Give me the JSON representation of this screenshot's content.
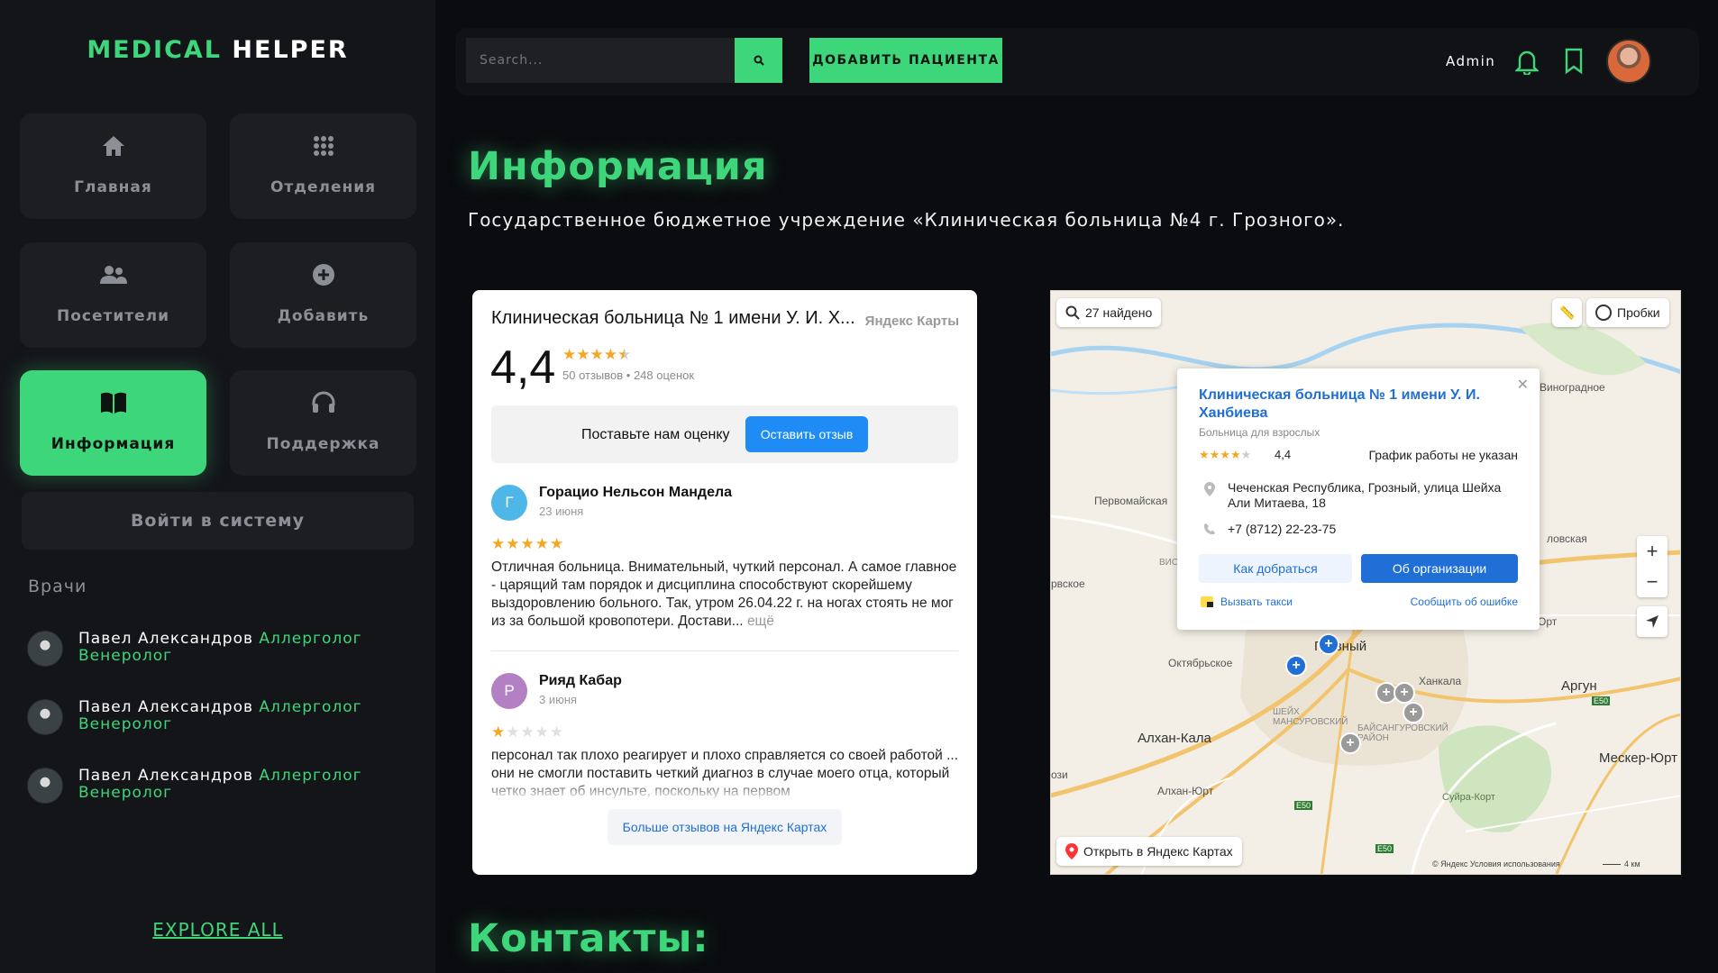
{
  "logo": {
    "part1": "MEDICAL",
    "part2": "HELPER"
  },
  "nav": [
    {
      "label": "Главная",
      "icon": "home-icon"
    },
    {
      "label": "Отделения",
      "icon": "grid-icon"
    },
    {
      "label": "Посетители",
      "icon": "users-icon"
    },
    {
      "label": "Добавить",
      "icon": "plus-circle-icon"
    },
    {
      "label": "Информация",
      "icon": "book-icon",
      "active": true
    },
    {
      "label": "Поддержка",
      "icon": "headset-icon"
    }
  ],
  "login_label": "Войти в систему",
  "doctors": {
    "title": "Врачи",
    "items": [
      {
        "name": "Павел Александров",
        "spec1": "Аллерголог",
        "spec2": "Венеролог"
      },
      {
        "name": "Павел Александров",
        "spec1": "Аллерголог",
        "spec2": "Венеролог"
      },
      {
        "name": "Павел Александров",
        "spec1": "Аллерголог",
        "spec2": "Венеролог"
      }
    ],
    "explore_label": "EXPLORE ALL"
  },
  "topbar": {
    "search_placeholder": "Search...",
    "add_patient_label": "ДОБАВИТЬ ПАЦИЕНТА",
    "user_label": "Admin"
  },
  "main": {
    "title": "Информация",
    "subtitle": "Государственное бюджетное учреждение «Клиническая больница №4 г. Грозного».",
    "contacts_title": "Контакты:"
  },
  "reviews": {
    "title": "Клиническая больница № 1 имени У. И. Х...",
    "brand": "Яндекс Карты",
    "score": "4,4",
    "rating": 4.4,
    "counts": "50 отзывов • 248 оценок",
    "rate_label": "Поставьте нам оценку",
    "rate_button": "Оставить отзыв",
    "items": [
      {
        "initial": "Г",
        "avatar_color": "#4fb6e8",
        "author": "Горацио Нельсон Мандела",
        "date": "23 июня",
        "stars": 5,
        "text": "Отличная больница. Внимательный, чуткий персонал. А самое главное - царящий там порядок и дисциплина способствуют скорейшему выздоровлению больного. Так, утром 26.04.22 г. на ногах стоять не мог из за большой кровопотери. Достави...",
        "more": "ещё"
      },
      {
        "initial": "Р",
        "avatar_color": "#b480c4",
        "author": "Рияд Кабар",
        "date": "3 июня",
        "stars": 1,
        "text": "персонал так плохо реагирует и плохо справляется со своей работой ... они не смогли поставить четкий диагноз в случае моего отца, который четко знает об инсульте, поскольку на первом",
        "more": ""
      }
    ],
    "more_button": "Больше отзывов на Яндекс Картах"
  },
  "map": {
    "found_label": "27 найдено",
    "traffic_label": "Пробки",
    "popup": {
      "title": "Клиническая больница № 1 имени У. И. Ханбиева",
      "category": "Больница для взрослых",
      "rating": "4,4",
      "schedule": "График работы не указан",
      "address": "Чеченская Республика, Грозный, улица Шейха Али Митаева, 18",
      "phone": "+7 (8712) 22-23-75",
      "route_button": "Как добраться",
      "org_button": "Об организации",
      "taxi_link": "Вызвать такси",
      "error_link": "Сообщить об ошибке"
    },
    "labels": [
      "Виноградное",
      "Первомайская",
      "Октябрьское",
      "Ханкала",
      "Аргун",
      "Алхан-Кала",
      "Алхан-Юрт",
      "Мескер-Юрт",
      "Суйра-Корт",
      "Грозный",
      "ловская",
      "рвское",
      "Орт",
      "ВИС",
      "ози",
      "ШЕЙХ МАНСУРОВСКИЙ",
      "БАЙСАНГУРОВСКИЙ РАЙОН"
    ],
    "road_labels": [
      "E50",
      "E50",
      "E50"
    ],
    "open_label": "Открыть в Яндекс Картах",
    "copyright": "© Яндекс   Условия использования",
    "scale": "4 км",
    "zoom_in": "+",
    "zoom_out": "−"
  },
  "colors": {
    "accent": "#3ed67a",
    "background": "#0b0c0f",
    "sidebar": "#141519",
    "link_blue": "#1f6fd6"
  }
}
